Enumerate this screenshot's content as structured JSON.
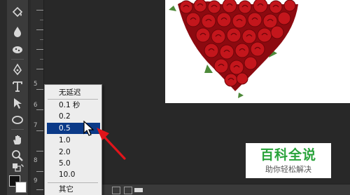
{
  "zoom_menu": {
    "items": [
      {
        "label": "无延迟"
      },
      {
        "label": "0.1 秒"
      },
      {
        "label": "0.2"
      },
      {
        "label": "0.5",
        "selected": true
      },
      {
        "label": "1.0"
      },
      {
        "label": "2.0"
      },
      {
        "label": "5.0"
      },
      {
        "label": "10.0"
      },
      {
        "label": "其它"
      }
    ]
  },
  "ruler": {
    "labels": [
      "5",
      "6",
      "7",
      "8",
      "9"
    ]
  },
  "tools": [
    {
      "icon": "paint-bucket-icon"
    },
    {
      "icon": "blur-drop-icon"
    },
    {
      "icon": "sponge-icon"
    },
    {
      "icon": "pen-icon"
    },
    {
      "icon": "type-icon"
    },
    {
      "icon": "path-select-icon"
    },
    {
      "icon": "ellipse-shape-icon"
    },
    {
      "icon": "hand-icon"
    },
    {
      "icon": "zoom-icon"
    }
  ],
  "swatches": {
    "foreground": "#111111",
    "background": "#ffffff"
  },
  "watermark": {
    "title": "百科全说",
    "subtitle": "助你轻松解决"
  },
  "colors": {
    "selection": "#0b3a88",
    "annotation_arrow": "#e0141a",
    "rose": "#c4161c"
  }
}
